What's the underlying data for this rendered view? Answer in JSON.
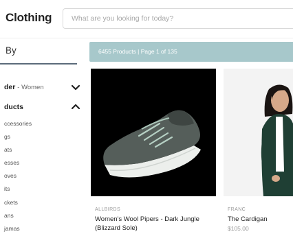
{
  "header": {
    "brand": "Clothing",
    "search_placeholder": "What are you looking for today?"
  },
  "sidebar": {
    "title": "By",
    "facets": [
      {
        "label": "der",
        "value": "- Women",
        "expanded": false
      },
      {
        "label": "ducts",
        "value": "",
        "expanded": true
      }
    ],
    "items": [
      "ccessories",
      "gs",
      "ats",
      "esses",
      "oves",
      "its",
      "ckets",
      "ans",
      "jamas"
    ]
  },
  "results": {
    "summary": "6455 Products | Page 1 of 135"
  },
  "products": [
    {
      "brand": "ALLBIRDS",
      "name": "Women's Wool Pipers - Dark Jungle (Blizzard Sole)",
      "price": ""
    },
    {
      "brand": "FRANC",
      "name": "The Cardigan",
      "price": "$105.00"
    }
  ],
  "colors": {
    "results_bar": "#a7c8cb",
    "filter_rule": "#5b6b7a",
    "shoe": "#555e5a",
    "cardigan": "#1f3f34"
  }
}
